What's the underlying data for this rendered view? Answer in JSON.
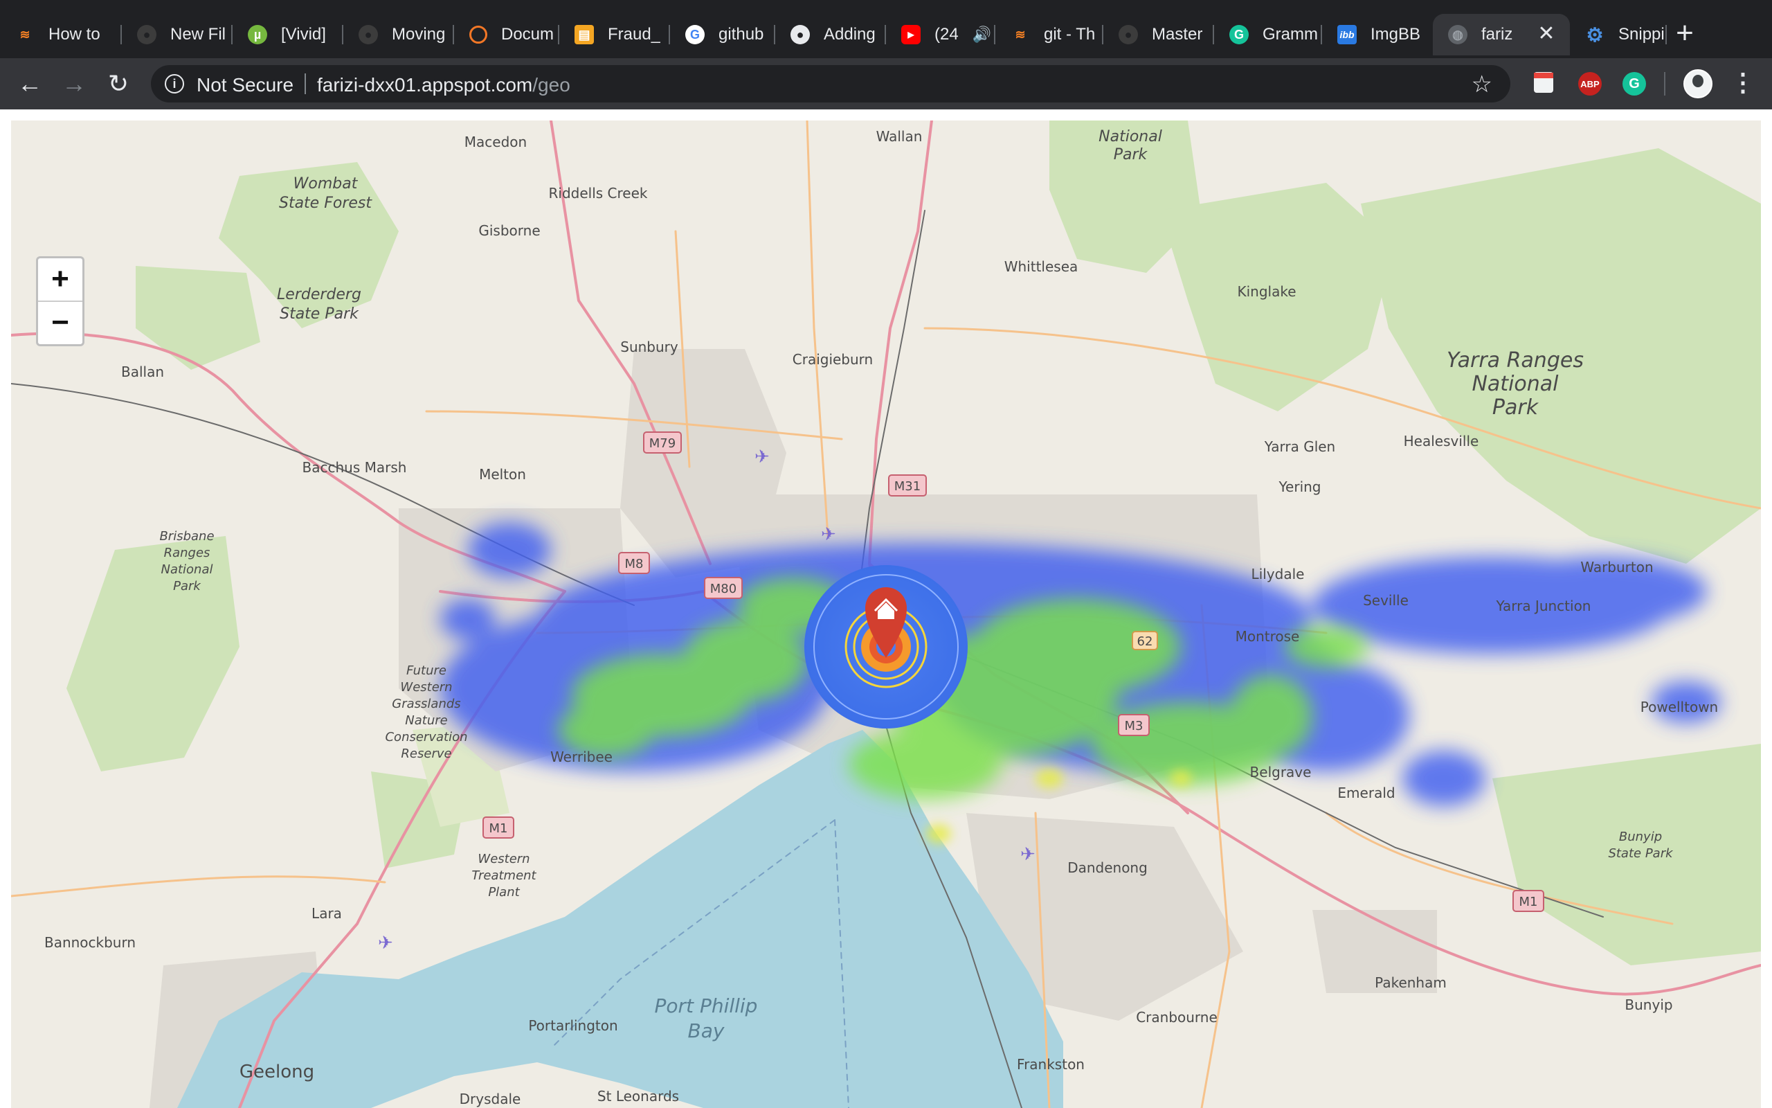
{
  "tabs": [
    {
      "label": "How to",
      "icon": "stackoverflow-icon",
      "color": "#f48024"
    },
    {
      "label": "New Fil",
      "icon": "github-icon",
      "color": "#2b2b2b"
    },
    {
      "label": "[Vivid]",
      "icon": "utorrent-icon",
      "color": "#76b83f"
    },
    {
      "label": "Moving",
      "icon": "github-icon",
      "color": "#2b2b2b"
    },
    {
      "label": "Docum",
      "icon": "jupyter-icon",
      "color": "#f37726"
    },
    {
      "label": "Fraud_",
      "icon": "notebook-icon",
      "color": "#f4a623"
    },
    {
      "label": "github",
      "icon": "google-icon",
      "color": "#ffffff"
    },
    {
      "label": "Adding",
      "icon": "github-icon",
      "color": "#2b2b2b"
    },
    {
      "label": "(24",
      "icon": "youtube-icon",
      "color": "#ff0000"
    },
    {
      "label": "git - Th",
      "icon": "stackoverflow-icon",
      "color": "#f48024"
    },
    {
      "label": "Master",
      "icon": "github-icon",
      "color": "#2b2b2b"
    },
    {
      "label": "Gramm",
      "icon": "grammarly-icon",
      "color": "#15c39a"
    },
    {
      "label": "ImgBB",
      "icon": "imgbb-icon",
      "color": "#2a7ae2"
    },
    {
      "label": "fariz",
      "icon": "globe-icon",
      "color": "#5f6368"
    },
    {
      "label": "Snippin",
      "icon": "gear-icon",
      "color": "#4a90e2"
    }
  ],
  "toolbar": {
    "security_label": "Not Secure",
    "url_host": "farizi-dxx01.appspot.com",
    "url_path": "/geo",
    "ext_abp": "ABP"
  },
  "map": {
    "zoom_in": "+",
    "zoom_out": "−",
    "places": {
      "macedon": "Macedon",
      "wallan": "Wallan",
      "kinglake_np": "Kinglake",
      "np": "National",
      "park": "Park",
      "wombat1": "Wombat",
      "wombat2": "State Forest",
      "riddells": "Riddells Creek",
      "gisborne": "Gisborne",
      "whittlesea": "Whittlesea",
      "kinglake": "Kinglake",
      "lerderderg1": "Lerderderg",
      "lerderderg2": "State Park",
      "sunbury": "Sunbury",
      "craigieburn": "Craigieburn",
      "yarra1": "Yarra Ranges",
      "yarra2": "National",
      "yarra3": "Park",
      "ballan": "Ballan",
      "healesville": "Healesville",
      "yarraglen": "Yarra Glen",
      "bacchus": "Bacchus Marsh",
      "melton": "Melton",
      "yering": "Yering",
      "brisbane1": "Brisbane",
      "brisbane2": "Ranges",
      "brisbane3": "National",
      "brisbane4": "Park",
      "lilydale": "Lilydale",
      "warburton": "Warburton",
      "seville": "Seville",
      "yarrajunction": "Yarra Junction",
      "montrose": "Montrose",
      "future1": "Future",
      "future2": "Western",
      "future3": "Grasslands",
      "future4": "Nature",
      "future5": "Conservation",
      "future6": "Reserve",
      "powelltown": "Powelltown",
      "werribee": "Werribee",
      "belgrave": "Belgrave",
      "emerald": "Emerald",
      "western1": "Western",
      "western2": "Treatment",
      "western3": "Plant",
      "dandenong": "Dandenong",
      "bunyip1": "Bunyip",
      "bunyip2": "State Park",
      "lara": "Lara",
      "bannockburn": "Bannockburn",
      "pakenham": "Pakenham",
      "bunyip": "Bunyip",
      "portphillip1": "Port Phillip",
      "portphillip2": "Bay",
      "portarlington": "Portarlington",
      "cranbourne": "Cranbourne",
      "geelong": "Geelong",
      "frankston": "Frankston",
      "drysdale": "Drysdale",
      "stleonards": "St Leonards"
    },
    "roads": {
      "m79": "M79",
      "m31": "M31",
      "m8": "M8",
      "m80": "M80",
      "m1a": "M1",
      "m3": "M3",
      "m1b": "M1",
      "r62": "62"
    }
  }
}
